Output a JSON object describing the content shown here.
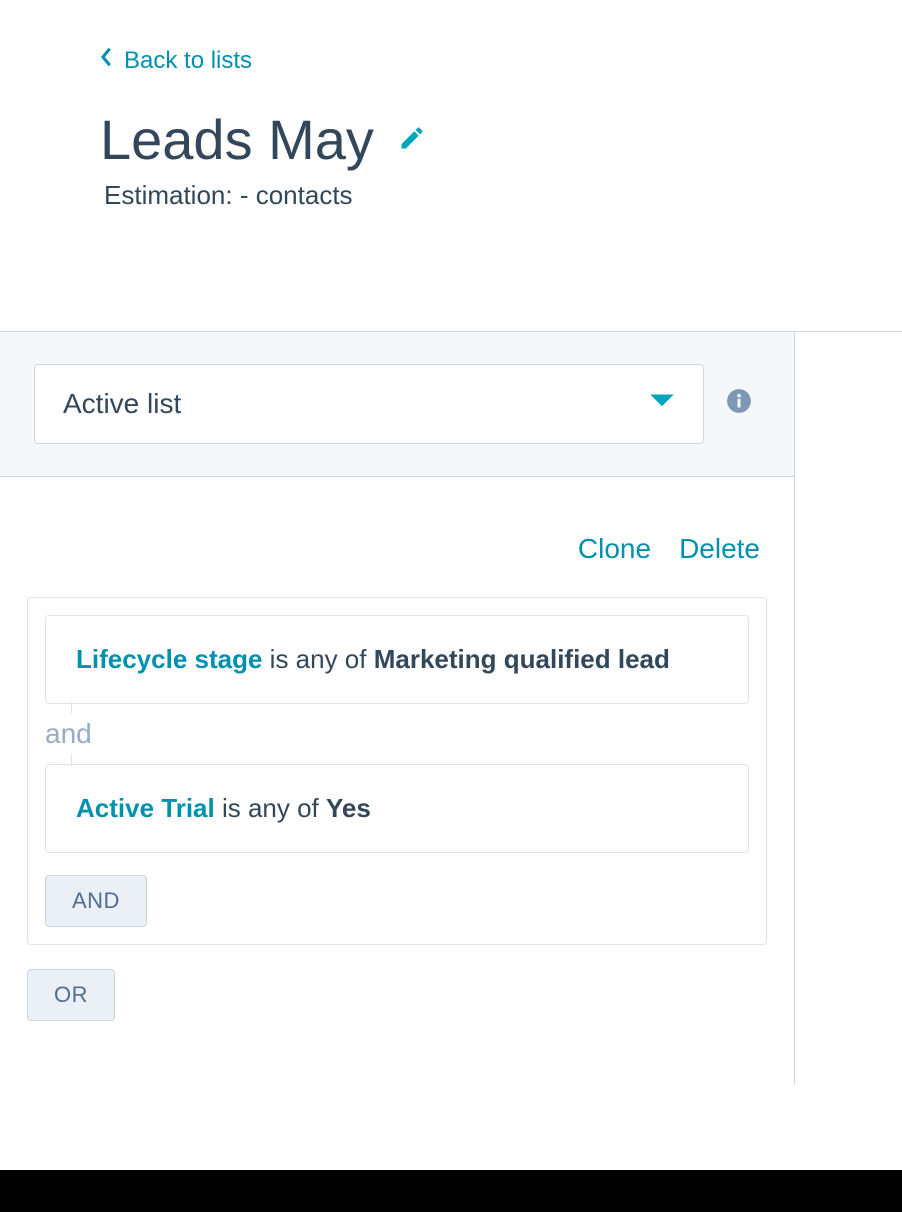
{
  "nav": {
    "back_label": "Back to lists"
  },
  "header": {
    "title": "Leads May",
    "estimation": "Estimation: - contacts"
  },
  "list_type_select": {
    "value": "Active list"
  },
  "actions": {
    "clone": "Clone",
    "delete": "Delete"
  },
  "group": {
    "conditions": [
      {
        "property": "Lifecycle stage",
        "operator": " is any of ",
        "value": "Marketing qualified lead"
      },
      {
        "property": "Active Trial",
        "operator": " is any of ",
        "value": "Yes"
      }
    ],
    "separator": "and",
    "add_and_label": "AND"
  },
  "add_or_label": "OR"
}
